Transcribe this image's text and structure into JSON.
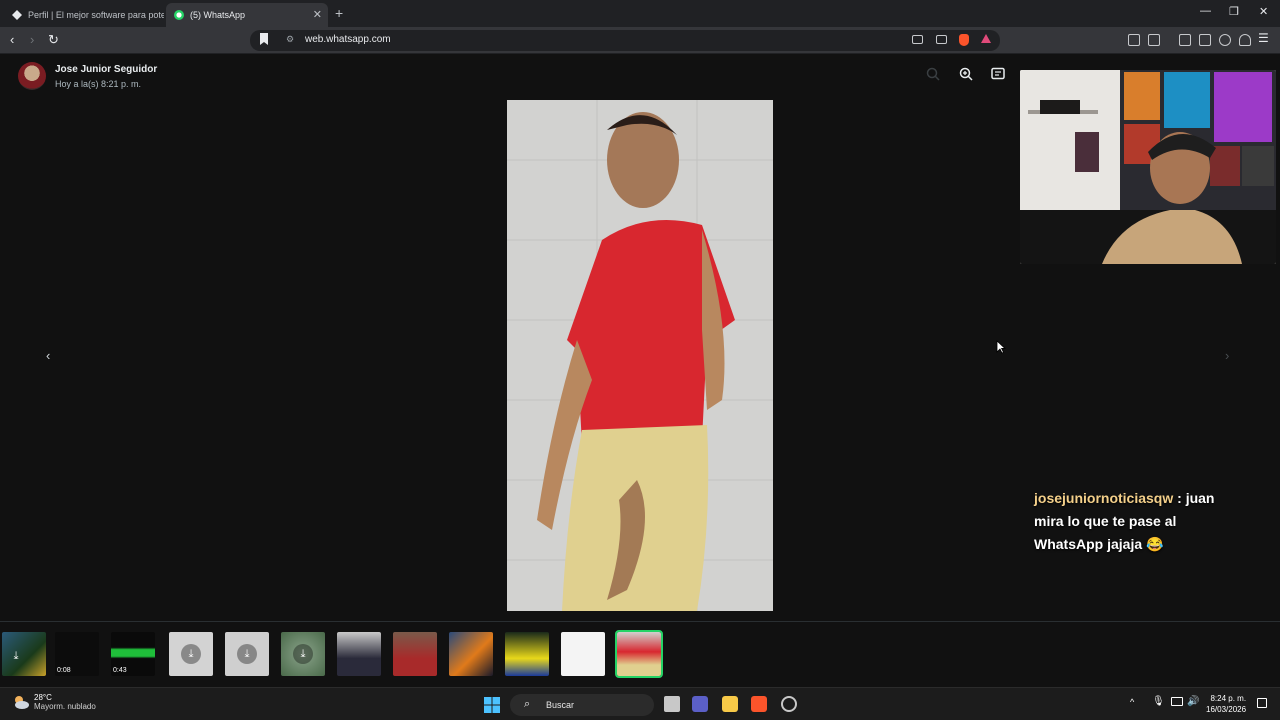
{
  "browser": {
    "tabs": [
      {
        "title": "Perfil | El mejor software para potenc",
        "active": false
      },
      {
        "title": "(5) WhatsApp",
        "active": true
      }
    ],
    "url": "web.whatsapp.com"
  },
  "viewer": {
    "sender": "Jose Junior Seguidor",
    "time": "Hoy a la(s) 8:21 p. m.",
    "thumbs": [
      {
        "kind": "download",
        "duration": ""
      },
      {
        "kind": "video",
        "duration": "0:08"
      },
      {
        "kind": "video",
        "duration": "0:43"
      },
      {
        "kind": "download",
        "duration": ""
      },
      {
        "kind": "download",
        "duration": ""
      },
      {
        "kind": "download",
        "duration": ""
      },
      {
        "kind": "image",
        "duration": ""
      },
      {
        "kind": "image",
        "duration": ""
      },
      {
        "kind": "image",
        "duration": ""
      },
      {
        "kind": "image",
        "duration": ""
      },
      {
        "kind": "image",
        "duration": ""
      },
      {
        "kind": "image",
        "duration": "",
        "selected": true
      }
    ]
  },
  "stream_chat": {
    "username": "josejuniornoticiasqw",
    "message": "juan mira lo que te pase al WhatsApp jajaja",
    "emoji": "😂"
  },
  "taskbar": {
    "temperature": "28°C",
    "weather": "Mayorm. nublado",
    "search_placeholder": "Buscar",
    "time": "8:24 p. m.",
    "date": "16/03/2026"
  },
  "colors": {
    "accent": "#25d366",
    "chat_user": "#f4d08a"
  }
}
